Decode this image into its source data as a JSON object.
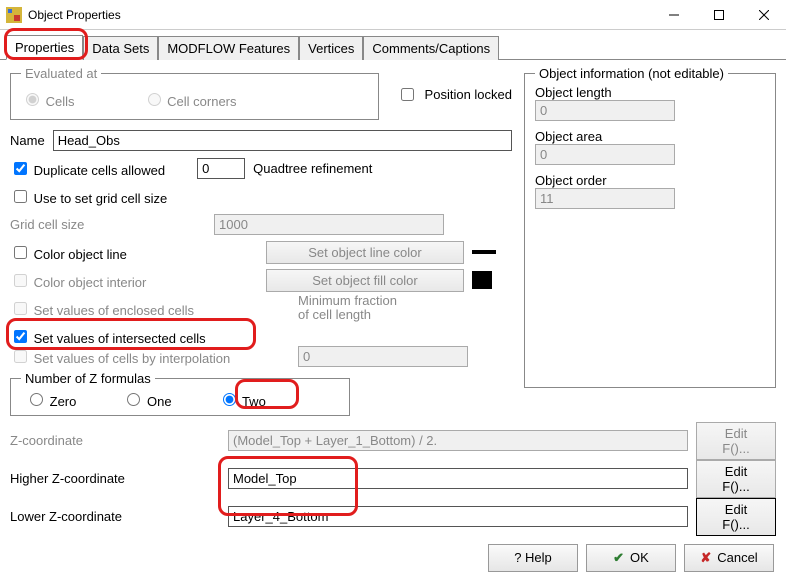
{
  "window": {
    "title": "Object Properties"
  },
  "tabs": [
    "Properties",
    "Data Sets",
    "MODFLOW Features",
    "Vertices",
    "Comments/Captions"
  ],
  "evalAt": {
    "legend": "Evaluated at",
    "cells": "Cells",
    "corners": "Cell corners"
  },
  "posLocked": "Position locked",
  "nameLbl": "Name",
  "nameVal": "Head_Obs",
  "dupAllowed": "Duplicate cells allowed",
  "quadVal": "0",
  "quadLbl": "Quadtree refinement",
  "useGrid": "Use to set grid cell size",
  "gcsLbl": "Grid cell size",
  "gcsVal": "1000",
  "colLine": "Color object line",
  "colFill": "Color object interior",
  "btnLine": "Set object line color",
  "btnFill": "Set object fill color",
  "enclosed": "Set values of enclosed cells",
  "intersected": "Set values of intersected cells",
  "interp": "Set values of cells by interpolation",
  "minFrac": "Minimum fraction\nof cell length",
  "minFrac1": "Minimum fraction",
  "minFrac2": "of cell length",
  "minFracVal": "0",
  "zLegend": "Number of Z formulas",
  "zOpts": {
    "zero": "Zero",
    "one": "One",
    "two": "Two"
  },
  "zc": {
    "lbl": "Z-coordinate",
    "val": "(Model_Top + Layer_1_Bottom) / 2."
  },
  "hz": {
    "lbl": "Higher Z-coordinate",
    "val": "Model_Top"
  },
  "lz": {
    "lbl": "Lower Z-coordinate",
    "val": "Layer_4_Bottom"
  },
  "editF": "Edit F()...",
  "objInfo": {
    "legend": "Object information (not editable)",
    "len": "Object length",
    "lenV": "0",
    "area": "Object area",
    "areaV": "0",
    "order": "Object order",
    "orderV": "11"
  },
  "help": "? Help",
  "ok": "OK",
  "cancel": "Cancel"
}
